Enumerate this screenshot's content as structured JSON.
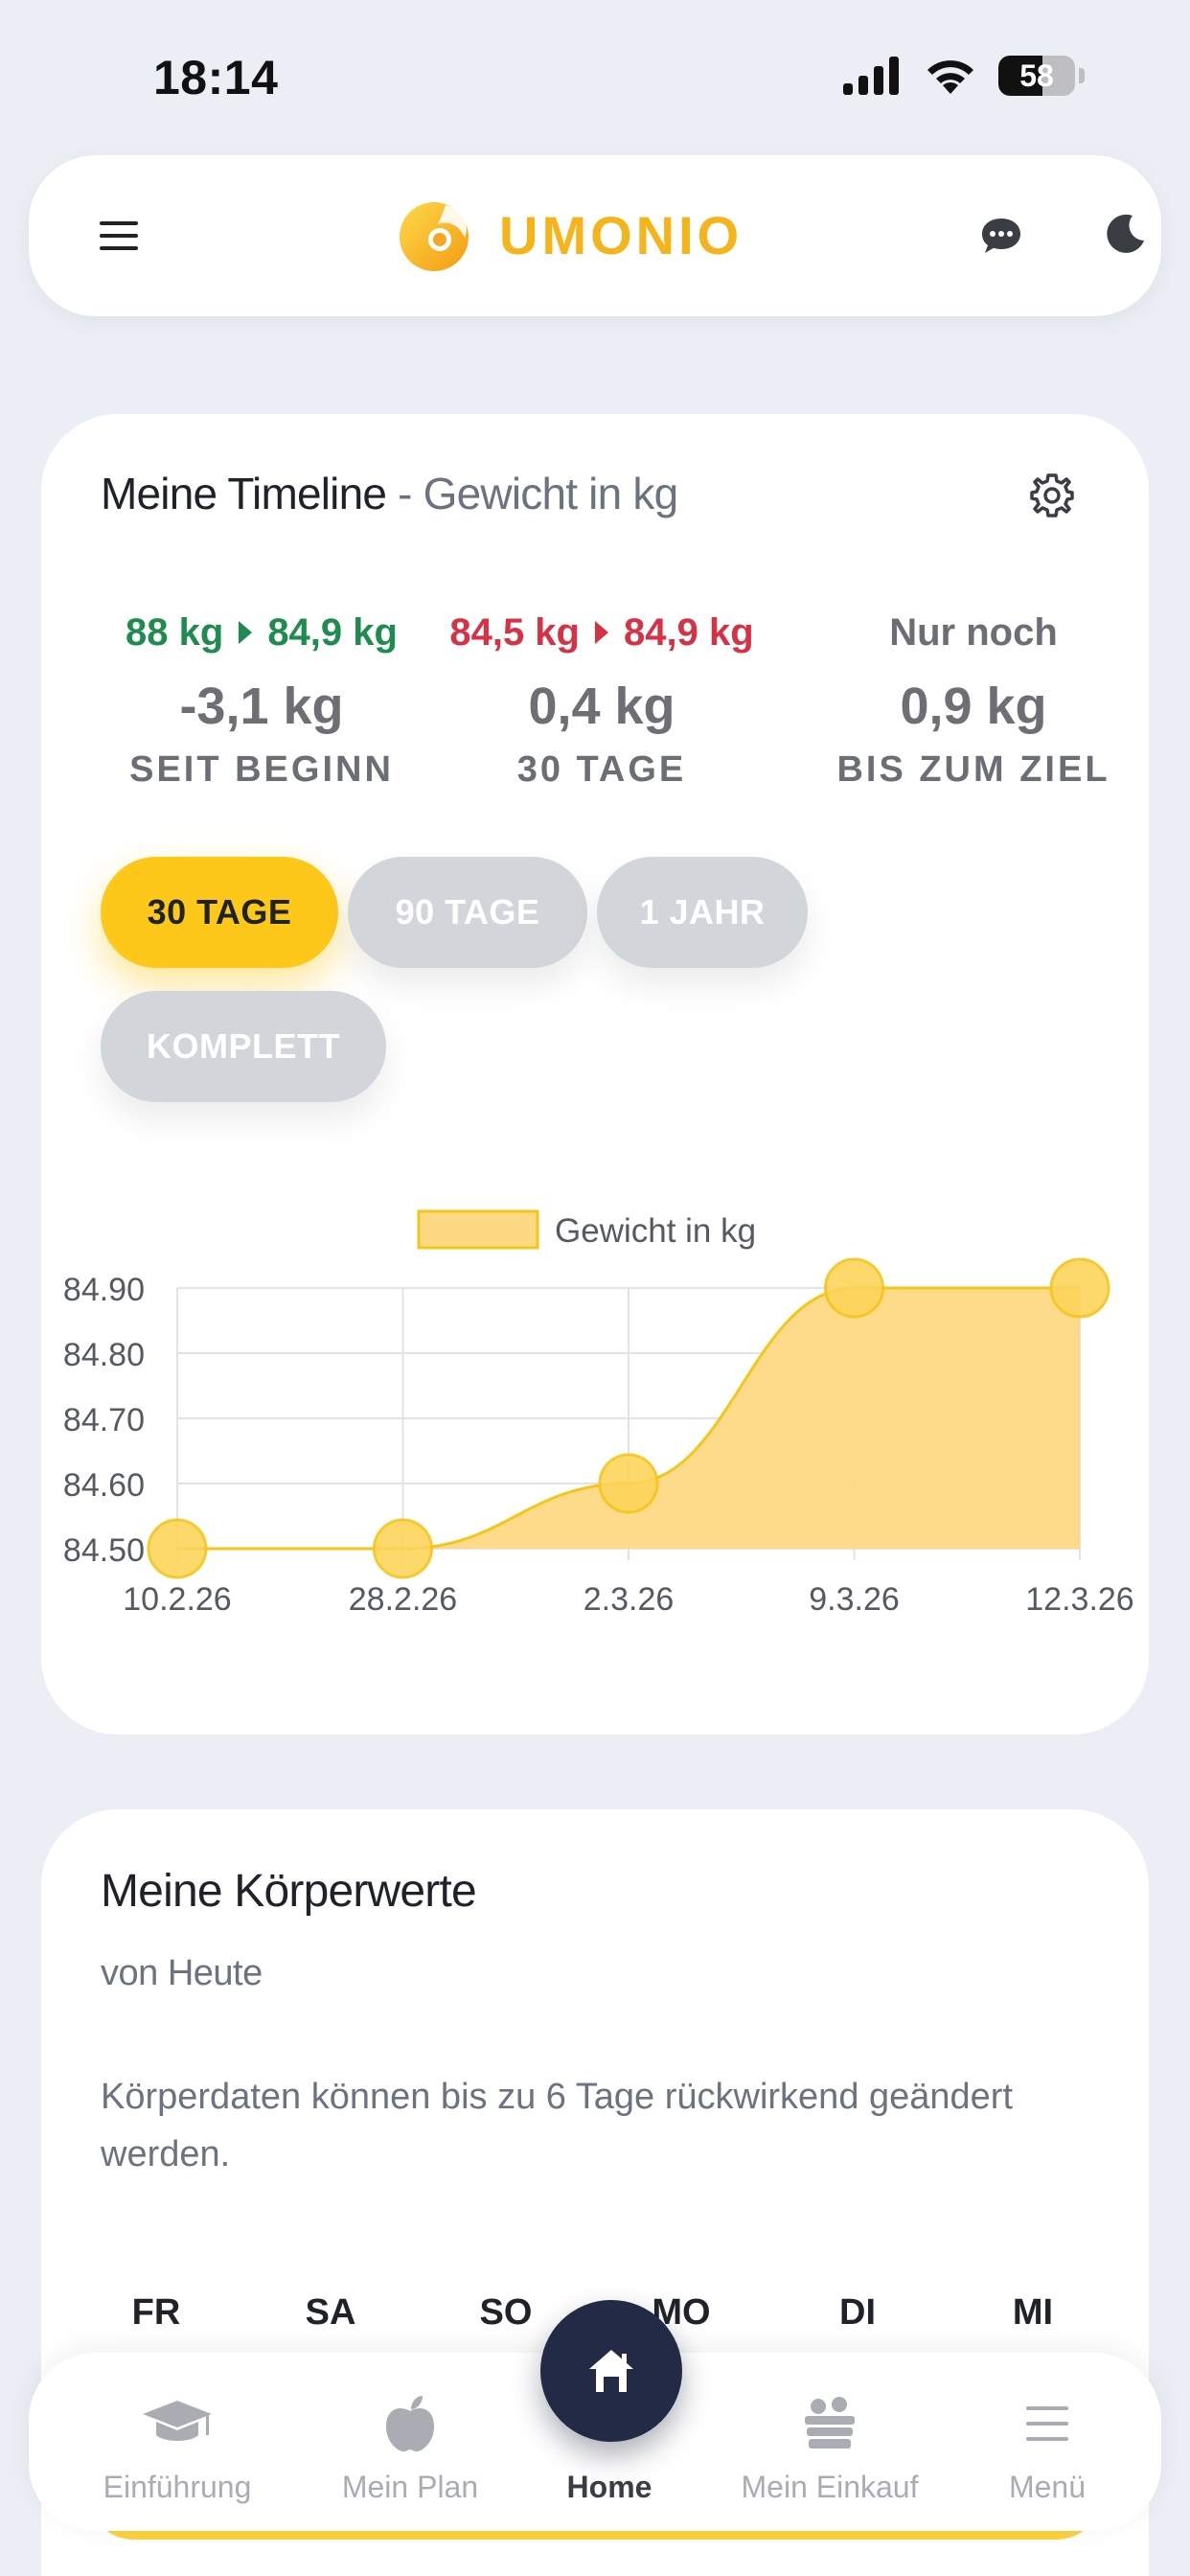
{
  "status_bar": {
    "time": "18:14",
    "battery": "58",
    "battery_level": 0.58
  },
  "header": {
    "brand": "UMONIO"
  },
  "timeline": {
    "title": "Meine Timeline",
    "subtitle": " - Gewicht in kg",
    "stats": [
      {
        "from": "88 kg",
        "to": "84,9 kg",
        "value": "-3,1 kg",
        "label": "SEIT BEGINN",
        "tone": "green"
      },
      {
        "from": "84,5 kg",
        "to": "84,9 kg",
        "value": "0,4 kg",
        "label": "30 TAGE",
        "tone": "red"
      },
      {
        "from": "Nur noch",
        "to": "",
        "value": "0,9 kg",
        "label": "BIS ZUM ZIEL",
        "tone": "muted"
      }
    ],
    "ranges": [
      "30 TAGE",
      "90 TAGE",
      "1 JAHR",
      "KOMPLETT"
    ],
    "active_range": "30 TAGE"
  },
  "chart_data": {
    "type": "area",
    "categories": [
      "10.2.26",
      "28.2.26",
      "2.3.26",
      "9.3.26",
      "12.3.26"
    ],
    "series": [
      {
        "name": "Gewicht in kg",
        "values": [
          84.5,
          84.5,
          84.6,
          84.9,
          84.9
        ]
      }
    ],
    "ylim": [
      84.5,
      84.9
    ],
    "yticks": [
      "84.50",
      "84.60",
      "84.70",
      "84.80",
      "84.90"
    ],
    "grid": true,
    "legend": "top",
    "colors": {
      "fill": "#fdd984",
      "line": "#f5c518",
      "point": "#fdd45a"
    }
  },
  "body_values": {
    "title": "Meine Körperwerte",
    "subtitle": "von Heute",
    "note": "Körperdaten können bis zu 6 Tage rückwirkend geändert werden.",
    "days": [
      "FR",
      "SA",
      "SO",
      "MO",
      "DI",
      "MI"
    ]
  },
  "nav": {
    "items": [
      {
        "label": "Einführung",
        "icon": "graduation-cap-icon"
      },
      {
        "label": "Mein Plan",
        "icon": "apple-icon"
      },
      {
        "label": "Home",
        "icon": "home-icon"
      },
      {
        "label": "Mein Einkauf",
        "icon": "grocery-basket-icon"
      },
      {
        "label": "Menü",
        "icon": "menu-icon"
      }
    ],
    "active": "Home"
  },
  "colors": {
    "accent": "#fdc81a",
    "brand": "#f4b41a",
    "green": "#1e8c4e",
    "red": "#d63246",
    "fab": "#232a45"
  }
}
